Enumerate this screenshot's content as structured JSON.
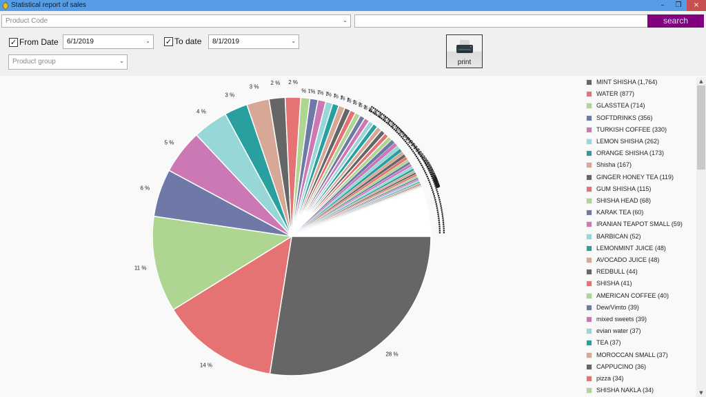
{
  "window": {
    "title": "Statistical report of sales",
    "minimize_glyph": "–",
    "maximize_glyph": "❐",
    "close_glyph": "×"
  },
  "filters": {
    "product_code_placeholder": "Product Code",
    "search_value": "",
    "search_label": "search",
    "from_date_label": "From Date",
    "from_date_checked": true,
    "from_date_value": "6/1/2019",
    "to_date_label": "To date",
    "to_date_checked": true,
    "to_date_value": "8/1/2019",
    "product_group_placeholder": "Product group",
    "print_label": "print",
    "check_glyph": "✓",
    "dropdown_glyph": "⌄"
  },
  "colors": {
    "titlebar": "#569de5",
    "search_button": "#800080",
    "close_button": "#c75050",
    "palette": [
      "#666666",
      "#e57373",
      "#aed591",
      "#6e79a8",
      "#cb78b5",
      "#98d7d7",
      "#29a09f",
      "#d7a896"
    ]
  },
  "chart_data": {
    "type": "pie",
    "title": "",
    "start_angle": "3 o'clock, clockwise",
    "legend_position": "right",
    "slices": [
      {
        "label": "MINT SHISHA",
        "value": 1764,
        "pct_label": "28 %"
      },
      {
        "label": "WATER",
        "value": 877,
        "pct_label": "14 %"
      },
      {
        "label": "GLASSTEA",
        "value": 714,
        "pct_label": "11 %"
      },
      {
        "label": "SOFTDRINKS",
        "value": 356,
        "pct_label": "6 %"
      },
      {
        "label": "TURKISH COFFEE",
        "value": 330,
        "pct_label": "5 %"
      },
      {
        "label": "LEMON SHISHA",
        "value": 262,
        "pct_label": "4 %"
      },
      {
        "label": "ORANGE SHISHA",
        "value": 173,
        "pct_label": "3 %"
      },
      {
        "label": "Shisha",
        "value": 167,
        "pct_label": "3 %"
      },
      {
        "label": "GINGER HONEY TEA",
        "value": 119,
        "pct_label": "2 %"
      },
      {
        "label": "GUM SHISHA",
        "value": 115,
        "pct_label": "2 %"
      },
      {
        "label": "SHISHA HEAD",
        "value": 68,
        "pct_label": "1 %"
      },
      {
        "label": "KARAK TEA",
        "value": 60,
        "pct_label": "1 %"
      },
      {
        "label": "IRANIAN TEAPOT SMALL",
        "value": 59,
        "pct_label": "1 %"
      },
      {
        "label": "BARBICAN",
        "value": 52,
        "pct_label": "1 %"
      },
      {
        "label": "LEMONMINT JUICE",
        "value": 48,
        "pct_label": "1 %"
      },
      {
        "label": "AVOCADO JUICE",
        "value": 48,
        "pct_label": "1 %"
      },
      {
        "label": "REDBULL",
        "value": 44,
        "pct_label": "1 %"
      },
      {
        "label": "SHISHA",
        "value": 41,
        "pct_label": "1 %"
      },
      {
        "label": "AMERICAN COFFEE",
        "value": 40,
        "pct_label": "1 %"
      },
      {
        "label": "Dew/Vimto",
        "value": 39,
        "pct_label": "1 %"
      },
      {
        "label": "mixed sweets",
        "value": 39,
        "pct_label": "1 %"
      },
      {
        "label": "evian water",
        "value": 37,
        "pct_label": "1 %"
      },
      {
        "label": "TEA",
        "value": 37,
        "pct_label": "1 %"
      },
      {
        "label": "MOROCCAN SMALL",
        "value": 37,
        "pct_label": "1 %"
      },
      {
        "label": "CAPPUCINO",
        "value": 36,
        "pct_label": "1 %"
      },
      {
        "label": "pizza",
        "value": 34,
        "pct_label": "1 %"
      },
      {
        "label": "SHISHA NAKLA",
        "value": 34,
        "pct_label": "1 %"
      }
    ],
    "unlabeled_tail_values": [
      30,
      29,
      28,
      26,
      25,
      24,
      22,
      21,
      20,
      19,
      18,
      17,
      16,
      15,
      14,
      13,
      12,
      11,
      10,
      9,
      8,
      7,
      6,
      5,
      4,
      3,
      2,
      1,
      1,
      1,
      1,
      1,
      1,
      1,
      1,
      1,
      1,
      1,
      1,
      1
    ],
    "unlabeled_tail_pct_labels": "0 %"
  },
  "legend_visible_count": 27
}
